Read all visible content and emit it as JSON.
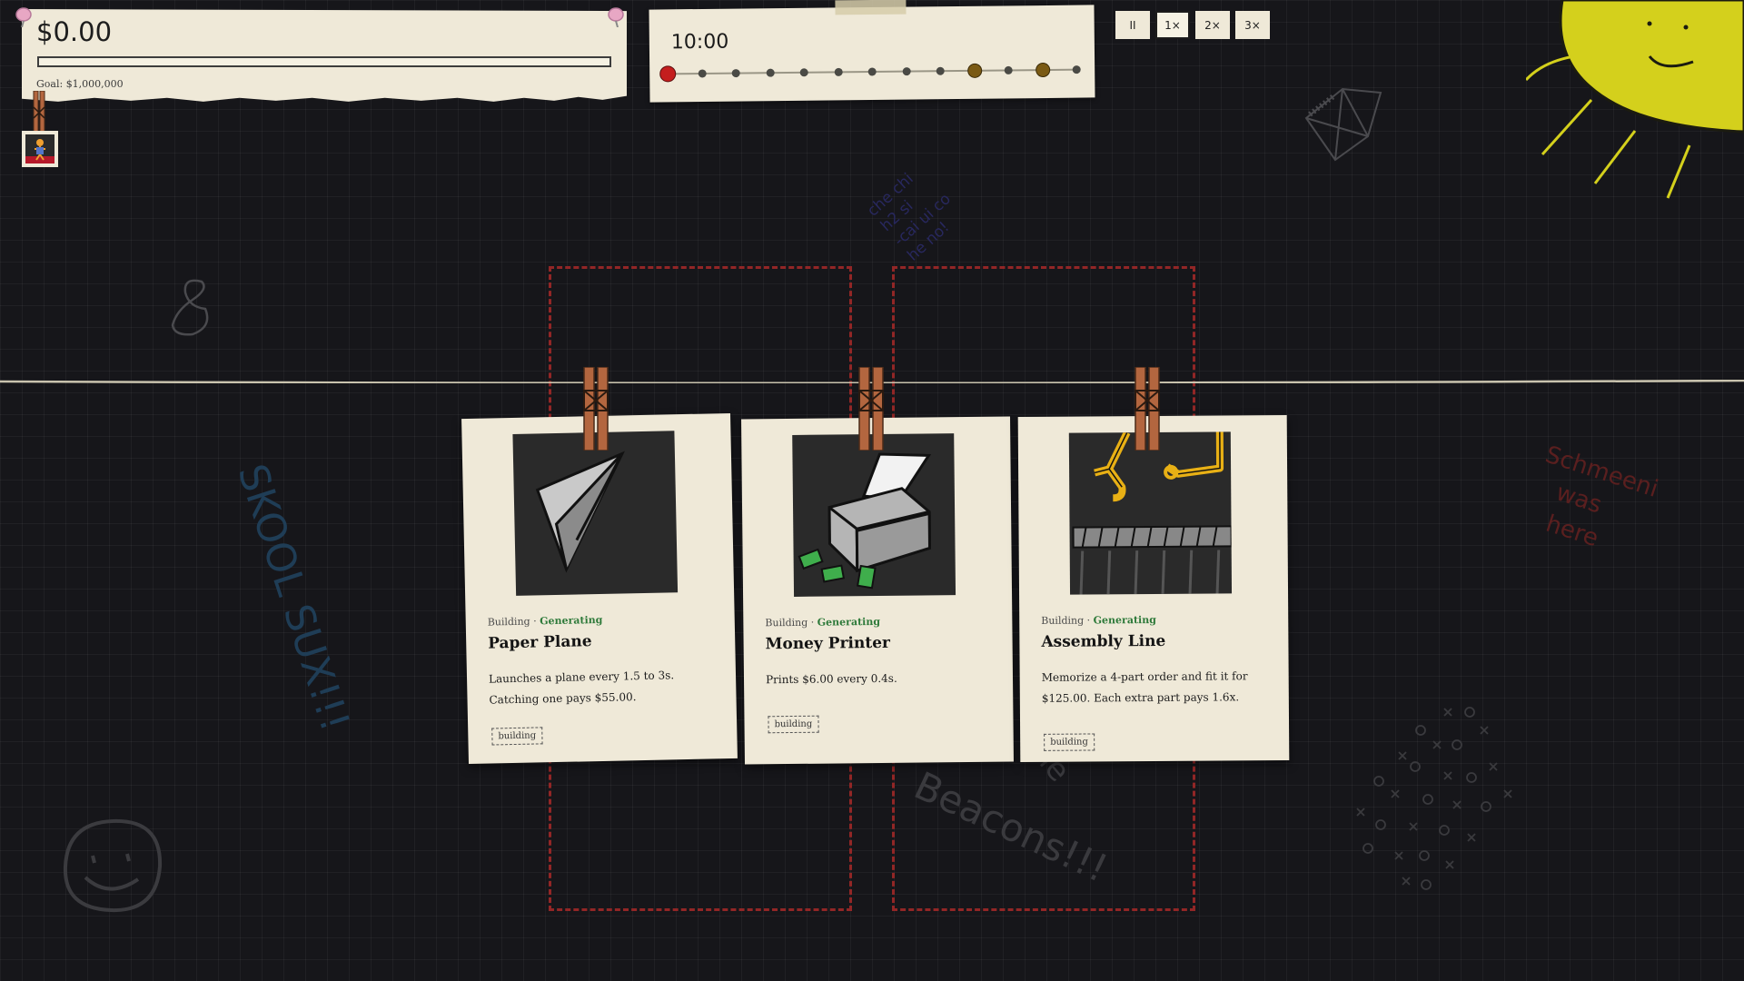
{
  "money": {
    "amount": "$0.00",
    "goal_label": "Goal: $1,000,000",
    "progress": 0
  },
  "timeline": {
    "clock": "10:00",
    "markers": [
      "current",
      "normal",
      "normal",
      "normal",
      "normal",
      "normal",
      "normal",
      "normal",
      "normal",
      "gold",
      "normal",
      "gold",
      "normal"
    ]
  },
  "speed": {
    "buttons": [
      {
        "label": "II",
        "name": "pause-button",
        "active": false
      },
      {
        "label": "1×",
        "name": "speed-1x-button",
        "active": true
      },
      {
        "label": "2×",
        "name": "speed-2x-button",
        "active": false
      },
      {
        "label": "3×",
        "name": "speed-3x-button",
        "active": false
      }
    ]
  },
  "cards": [
    {
      "meta_kind": "Building · ",
      "meta_status": "Generating",
      "title": "Paper Plane",
      "desc_line1": "Launches a plane every 1.5 to 3s.",
      "desc_line2": "Catching one pays $55.00.",
      "tag": "building",
      "icon": "paper-plane-icon"
    },
    {
      "meta_kind": "Building · ",
      "meta_status": "Generating",
      "title": "Money Printer",
      "desc_line1": "Prints $6.00 every 0.4s.",
      "desc_line2": "",
      "tag": "building",
      "icon": "money-printer-icon"
    },
    {
      "meta_kind": "Building · ",
      "meta_status": "Generating",
      "title": "Assembly Line",
      "desc_line1": "Memorize a 4-part order and fit it for",
      "desc_line2": "$125.00. Each extra part pays 1.6x.",
      "tag": "building",
      "icon": "assembly-line-icon"
    }
  ],
  "doodles": {
    "skool": "SKOOL SUX!!!",
    "schmeeni": [
      "Schmeeni",
      "was",
      "here"
    ],
    "beacons": "Beacons!!!",
    "the": "the",
    "scribble": [
      "che chi",
      "h2 si",
      "-cai ui co",
      "he no!"
    ]
  },
  "colors": {
    "paper": "#efe9d8",
    "board": "#16161a",
    "slot": "#922626",
    "sun": "#d4d01c",
    "generating": "#2e7a3a"
  }
}
